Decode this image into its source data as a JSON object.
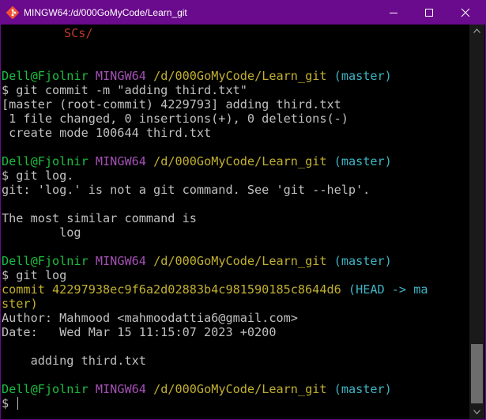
{
  "window": {
    "title": "MINGW64:/d/000GoMyCode/Learn_git"
  },
  "terminal": {
    "l0": "SCs/",
    "prompt": {
      "user": "Dell@Fjolnir",
      "shell": "MINGW64",
      "path": "/d/000GoMyCode/Learn_git",
      "branch": "(master)"
    },
    "cmd1": "$ git commit -m \"adding third.txt\"",
    "out1a": "[master (root-commit) 4229793] adding third.txt",
    "out1b": " 1 file changed, 0 insertions(+), 0 deletions(-)",
    "out1c": " create mode 100644 third.txt",
    "cmd2": "$ git log.",
    "out2a": "git: 'log.' is not a git command. See 'git --help'.",
    "out2b": "The most similar command is",
    "out2c": "        log",
    "cmd3": "$ git log",
    "commit_hash": "commit 42297938ec9f6a2d02883b4c981590185c8644d6",
    "head_ref_a": "(HEAD -> ma",
    "head_ref_b": "ster)",
    "author": "Author: Mahmood <mahmoodattia6@gmail.com>",
    "date": "Date:   Wed Mar 15 11:15:07 2023 +0200",
    "message": "    adding third.txt",
    "final_prompt": "$ "
  }
}
